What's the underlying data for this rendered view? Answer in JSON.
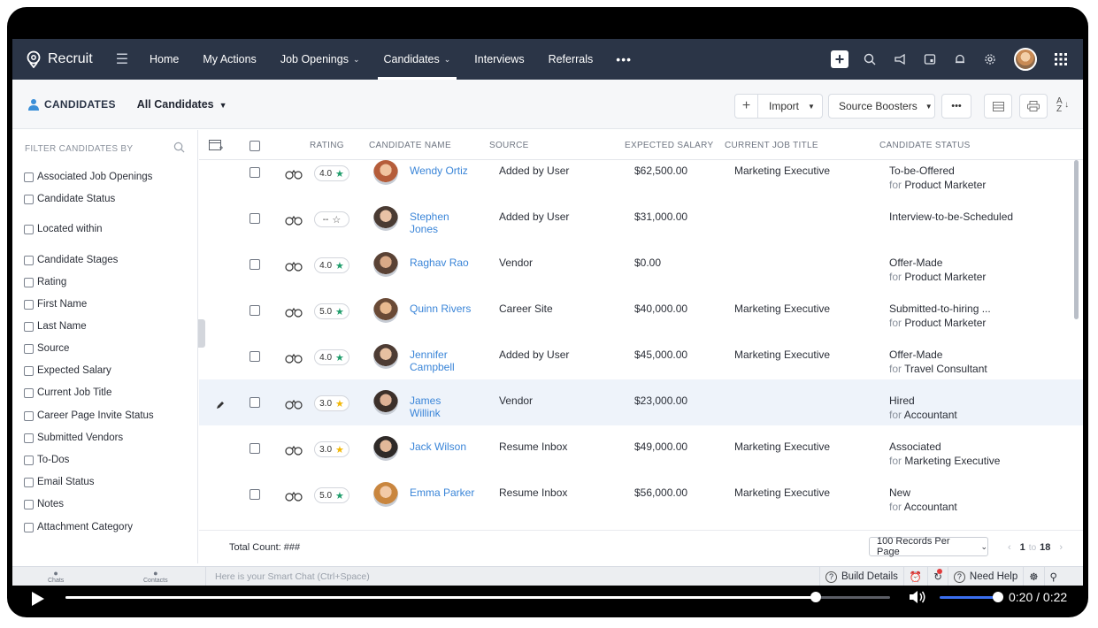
{
  "nav": {
    "brand": "Recruit",
    "items": [
      {
        "label": "Home",
        "caret": false,
        "active": false
      },
      {
        "label": "My Actions",
        "caret": false,
        "active": false
      },
      {
        "label": "Job Openings",
        "caret": true,
        "active": false
      },
      {
        "label": "Candidates",
        "caret": true,
        "active": true
      },
      {
        "label": "Interviews",
        "caret": false,
        "active": false
      },
      {
        "label": "Referrals",
        "caret": false,
        "active": false
      }
    ],
    "more": "•••"
  },
  "subheader": {
    "module": "CANDIDATES",
    "view": "All Candidates",
    "import_label": "Import",
    "source_boosters_label": "Source Boosters",
    "more_label": "•••"
  },
  "sidebar": {
    "heading": "FILTER CANDIDATES BY",
    "filters": [
      "Associated Job Openings",
      "Candidate Status",
      "Located within",
      "Candidate Stages",
      "Rating",
      "First Name",
      "Last Name",
      "Source",
      "Expected Salary",
      "Current Job Title",
      "Career Page Invite Status",
      "Submitted Vendors",
      "To-Dos",
      "Email Status",
      "Notes",
      "Attachment Category"
    ]
  },
  "table": {
    "columns": {
      "rating": "RATING",
      "name": "CANDIDATE NAME",
      "source": "SOURCE",
      "salary": "EXPECTED SALARY",
      "title": "CURRENT JOB TITLE",
      "status": "CANDIDATE STATUS"
    },
    "rows": [
      {
        "rating": "4.0",
        "star": "green",
        "name": "Wendy Ortiz",
        "source": "Added by User",
        "salary": "$62,500.00",
        "title": "Marketing Executive",
        "status": "To-be-Offered",
        "for": "Product Marketer"
      },
      {
        "rating": "--",
        "star": "empty",
        "name": "Stephen Jones",
        "source": "Added by User",
        "salary": "$31,000.00",
        "title": "",
        "status": "Interview-to-be-Scheduled",
        "for": ""
      },
      {
        "rating": "4.0",
        "star": "green",
        "name": "Raghav Rao",
        "source": "Vendor",
        "salary": "$0.00",
        "title": "",
        "status": "Offer-Made",
        "for": "Product Marketer"
      },
      {
        "rating": "5.0",
        "star": "green",
        "name": "Quinn Rivers",
        "source": "Career Site",
        "salary": "$40,000.00",
        "title": "Marketing Executive",
        "status": "Submitted-to-hiring ...",
        "for": "Product Marketer"
      },
      {
        "rating": "4.0",
        "star": "green",
        "name": "Jennifer Campbell",
        "source": "Added by User",
        "salary": "$45,000.00",
        "title": "Marketing Executive",
        "status": "Offer-Made",
        "for": "Travel Consultant"
      },
      {
        "rating": "3.0",
        "star": "yellow",
        "name": "James Willink",
        "source": "Vendor",
        "salary": "$23,000.00",
        "title": "",
        "status": "Hired",
        "for": "Accountant"
      },
      {
        "rating": "3.0",
        "star": "yellow",
        "name": "Jack Wilson",
        "source": "Resume Inbox",
        "salary": "$49,000.00",
        "title": "Marketing Executive",
        "status": "Associated",
        "for": "Marketing Executive"
      },
      {
        "rating": "5.0",
        "star": "green",
        "name": "Emma Parker",
        "source": "Resume Inbox",
        "salary": "$56,000.00",
        "title": "Marketing Executive",
        "status": "New",
        "for": "Accountant"
      }
    ],
    "for_prefix": "for",
    "total_count": "Total Count: ###",
    "per_page": "100 Records Per Page",
    "pager_from": "1",
    "pager_to_word": "to",
    "pager_to": "18"
  },
  "bottombar": {
    "chats": "Chats",
    "contacts": "Contacts",
    "smart_chat": "Here is your Smart Chat (Ctrl+Space)",
    "build_details": "Build Details",
    "need_help": "Need Help"
  },
  "video": {
    "progress": 0.91,
    "time": "0:20 / 0:22"
  },
  "colors": {
    "nav_bg": "#2b3547",
    "link": "#3a85d8",
    "star_green": "#1f9d6b",
    "star_yellow": "#f2b705",
    "highlight_row": "#eef3fa"
  }
}
